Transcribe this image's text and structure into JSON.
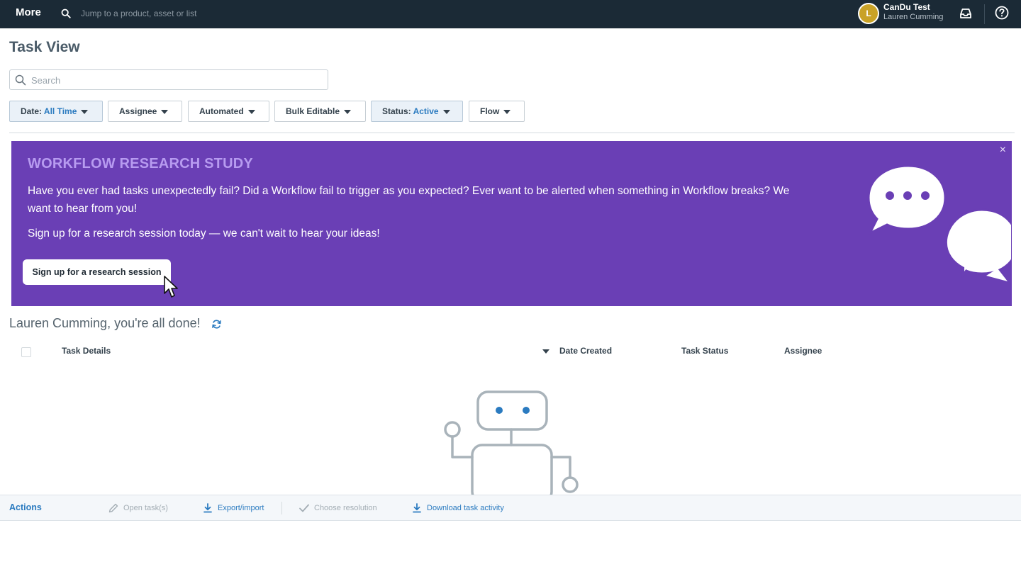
{
  "topbar": {
    "more_label": "More",
    "search_placeholder": "Jump to a product, asset or list",
    "avatar_initial": "L",
    "account_name": "CanDu Test",
    "account_user": "Lauren Cumming",
    "icons": [
      "search-icon",
      "inbox-icon",
      "help-icon"
    ]
  },
  "page": {
    "title": "Task View"
  },
  "search": {
    "placeholder": "Search"
  },
  "filters": {
    "date_label": "Date: ",
    "date_value": "All Time",
    "assignee": "Assignee",
    "automated": "Automated",
    "bulk_editable": "Bulk Editable",
    "status_label": "Status: ",
    "status_value": "Active",
    "flow": "Flow"
  },
  "banner": {
    "title": "WORKFLOW RESEARCH STUDY",
    "text1": "Have you ever had tasks unexpectedly fail? Did a Workflow fail to trigger as you expected? Ever want to be alerted when something in Workflow breaks? We want to hear from you!",
    "text2": "Sign up for a research session today — we can't wait to hear your ideas!",
    "button": "Sign up for a research session",
    "close": "×",
    "background_color": "#6a3fb5",
    "title_color": "#b79bf0"
  },
  "status_message": "Lauren Cumming, you're all done!",
  "table": {
    "columns": [
      "Task Details",
      "Date Created",
      "Task Status",
      "Assignee"
    ]
  },
  "actions": {
    "title": "Actions",
    "open_tasks": "Open task(s)",
    "export_import": "Export/import",
    "choose_resolution": "Choose resolution",
    "download_activity": "Download task activity"
  },
  "colors": {
    "topbar": "#1b2a36",
    "accent": "#2b7bc0"
  }
}
